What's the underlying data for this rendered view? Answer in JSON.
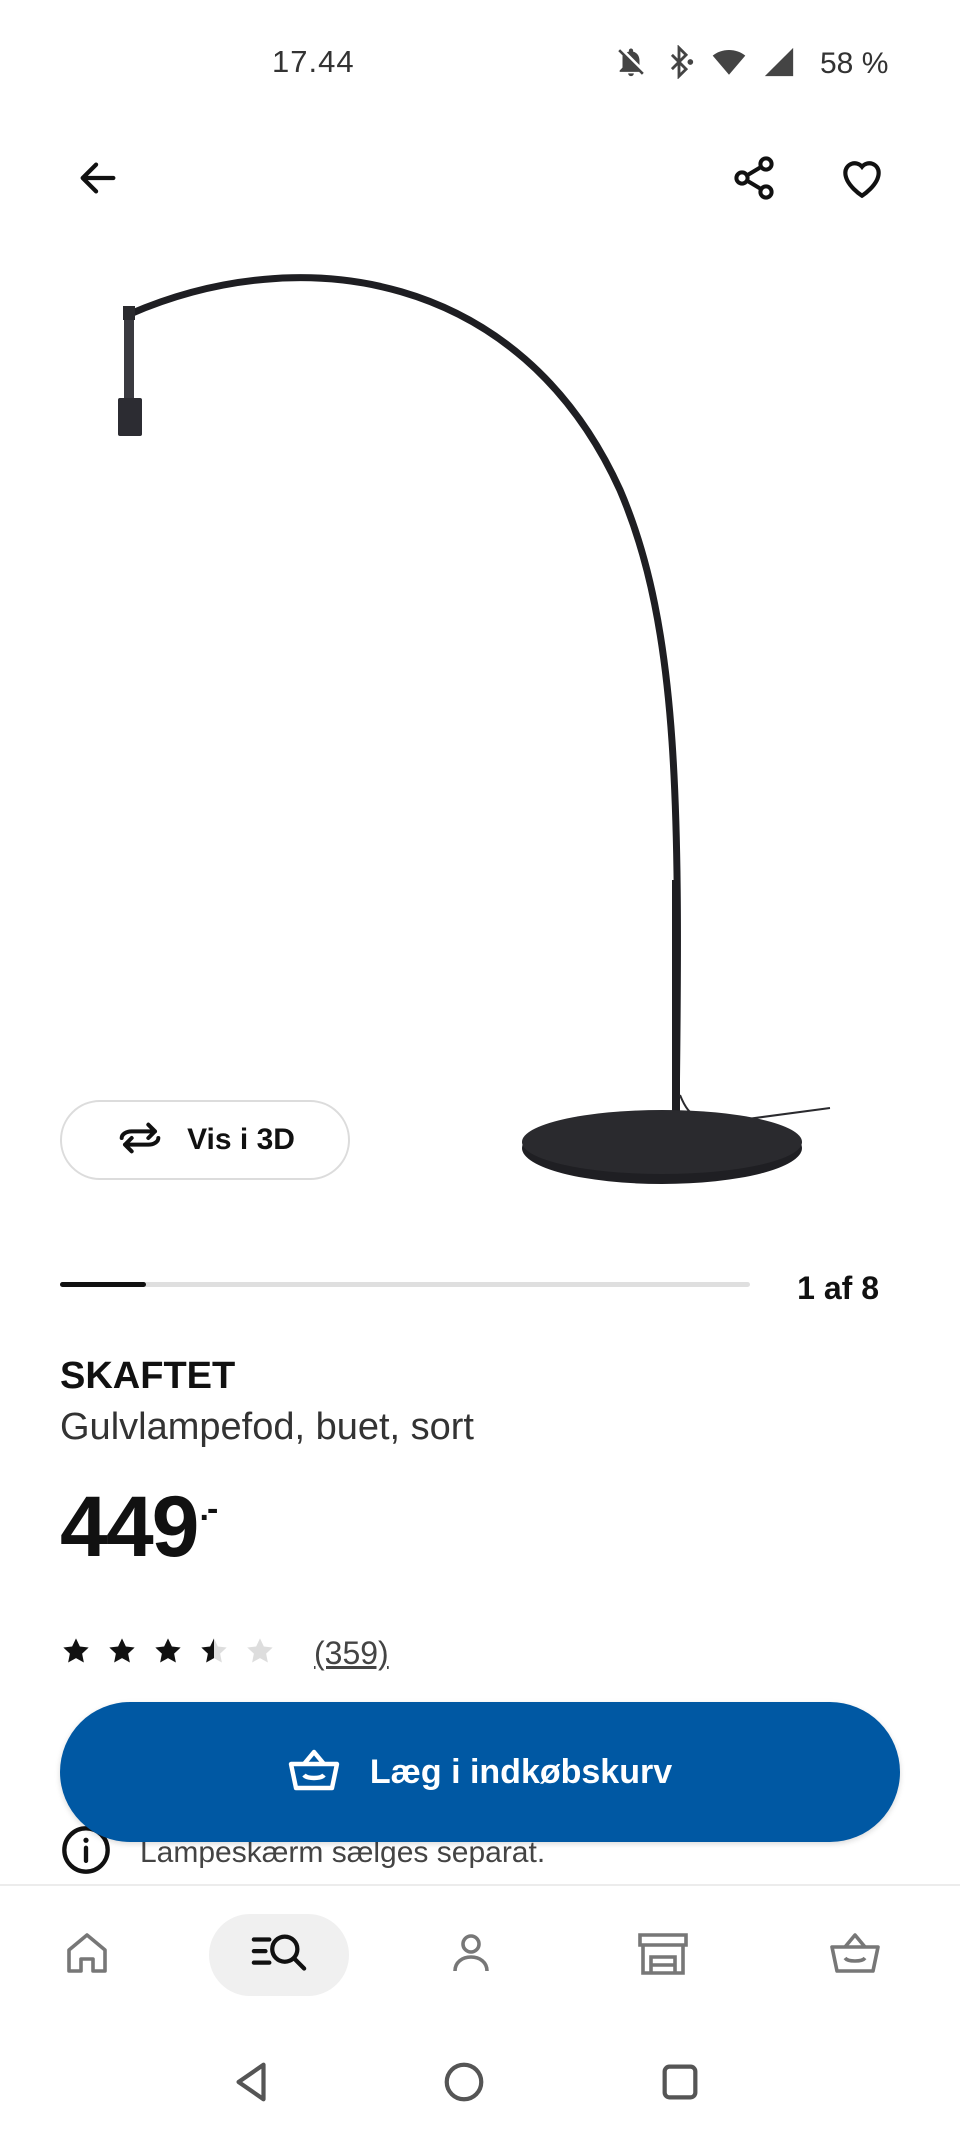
{
  "status_bar": {
    "time": "17.44",
    "battery": "58 %",
    "icons": [
      "bell-off-icon",
      "bluetooth-icon",
      "wifi-icon",
      "cellular-signal-icon"
    ]
  },
  "header": {
    "icons": [
      "back-arrow-icon",
      "share-icon",
      "heart-icon"
    ]
  },
  "gallery": {
    "view_3d_label": "Vis i 3D",
    "counter": "1 af 8",
    "progress": 0.125
  },
  "product": {
    "name": "SKAFTET",
    "description": "Gulvlampefod, buet, sort",
    "price": "449",
    "price_suffix": ".-",
    "rating": 3.5,
    "rating_max": 5,
    "review_count": "(359)",
    "info": "Lampeskærm sælges separat."
  },
  "actions": {
    "add_to_cart": "Læg i indkøbskurv"
  },
  "bottom_nav": {
    "items": [
      "home-icon",
      "search-icon",
      "profile-icon",
      "store-icon",
      "basket-icon"
    ],
    "active": "search-icon"
  },
  "colors": {
    "primary": "#0058a3",
    "text": "#111111",
    "muted": "#444444"
  }
}
